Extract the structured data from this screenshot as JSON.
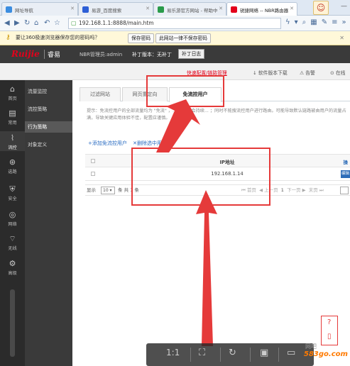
{
  "browser": {
    "tabs": [
      {
        "label": "网址导航",
        "active": false
      },
      {
        "label": "易游_百度搜索",
        "active": false
      },
      {
        "label": "易乐游官方网站 - 帮助中",
        "active": false
      },
      {
        "label": "锐捷网络 -- NBR路由器",
        "active": true
      }
    ],
    "address": "192.168.1.1:8888/main.htm",
    "password_bar": {
      "message": "要让360极速浏览器保存您的密码吗？",
      "save_label": "保存密码",
      "never_label": "此网站一律不保存密码"
    }
  },
  "header": {
    "logo": "Ruijie",
    "logo_sub": "睿易",
    "admin_label": "NBR管理员:admin",
    "patch_label": "补丁版本：无补丁",
    "patch_log_button": "补丁日志",
    "subheader": {
      "quick_config": "快速配置/链路管理",
      "software_download": "软件版本下载",
      "alarm": "告警",
      "online": "在线"
    }
  },
  "iconbar": [
    {
      "icon": "home-icon",
      "label": "首页",
      "glyph": "⌂"
    },
    {
      "icon": "common-icon",
      "label": "常用",
      "glyph": "▤"
    },
    {
      "icon": "flow-control-icon",
      "label": "流控",
      "glyph": "⌇",
      "active": true
    },
    {
      "icon": "route-icon",
      "label": "选路",
      "glyph": "⊛"
    },
    {
      "icon": "security-icon",
      "label": "安全",
      "glyph": "⛨"
    },
    {
      "icon": "network-icon",
      "label": "网络",
      "glyph": "◎"
    },
    {
      "icon": "wireless-icon",
      "label": "无线",
      "glyph": "⌔"
    },
    {
      "icon": "advanced-icon",
      "label": "高级",
      "glyph": "⚙"
    }
  ],
  "menu2": {
    "items": [
      {
        "label": "流量监控",
        "active": false
      },
      {
        "label": "流控策略",
        "active": false
      },
      {
        "label": "行为策略",
        "active": true
      },
      {
        "label": "对象定义",
        "active": false
      }
    ]
  },
  "main": {
    "tabs": [
      {
        "label": "过滤网站",
        "active": false
      },
      {
        "label": "网页重定向",
        "active": false
      },
      {
        "label": "免流控用户",
        "active": true
      }
    ],
    "tip": "提示：免流控用户的全部流量均为 \"免流\"  ，...  还会不会持续...  ；同时不能搜流控用户进行路由。可能导致默认链路被由用户的流量占满，导致关键应用体验不佳，配置应谨慎。",
    "add_label": "+添加免流控用户",
    "delete_label": "✕删除选中用户",
    "table": {
      "header_ip": "IP地址",
      "header_op": "操",
      "rows": [
        {
          "ip": "192.168.1.14",
          "edit": "编辑"
        }
      ]
    },
    "pager": {
      "show": "显示",
      "page_size": "10",
      "unit": "条 共 1 条",
      "first": "首页",
      "prev": "上一页",
      "current": "1",
      "next": "下一页",
      "last": "末页"
    }
  },
  "help": {
    "question": "?",
    "phone": "▯"
  },
  "overlay": {
    "ratio": "1:1",
    "watermark_cn": "网吧",
    "watermark": "583go.com"
  },
  "colors": {
    "accent_red": "#e3001b",
    "annotation_red": "#e53a3a",
    "link_blue": "#2a6cc2",
    "sidebar_dark": "#2b2b2b"
  }
}
